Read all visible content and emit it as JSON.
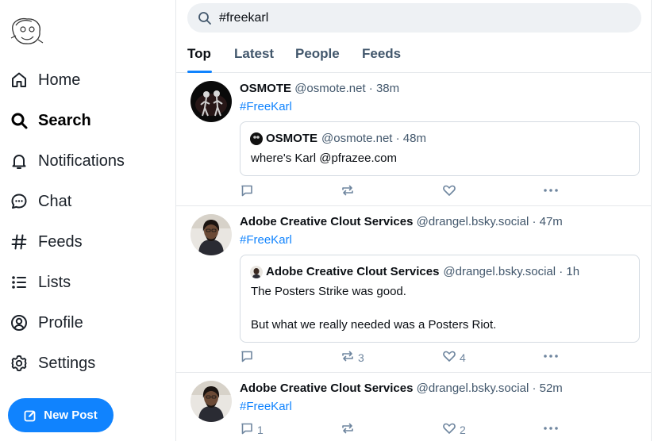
{
  "nav": {
    "items": [
      {
        "label": "Home",
        "icon": "home-icon"
      },
      {
        "label": "Search",
        "icon": "search-icon"
      },
      {
        "label": "Notifications",
        "icon": "bell-icon"
      },
      {
        "label": "Chat",
        "icon": "chat-icon"
      },
      {
        "label": "Feeds",
        "icon": "hash-icon"
      },
      {
        "label": "Lists",
        "icon": "list-icon"
      },
      {
        "label": "Profile",
        "icon": "profile-icon"
      },
      {
        "label": "Settings",
        "icon": "gear-icon"
      }
    ],
    "active": "Search",
    "new_post_label": "New Post"
  },
  "search": {
    "query": "#freekarl"
  },
  "tabs": [
    "Top",
    "Latest",
    "People",
    "Feeds"
  ],
  "colors": {
    "accent": "#1083fe",
    "muted": "#42576c",
    "icon_muted": "#6f869f"
  },
  "posts": [
    {
      "name": "OSMOTE",
      "handle": "@osmote.net · 38m",
      "tag": "#FreeKarl",
      "quote": {
        "name": "OSMOTE",
        "handle": "@osmote.net · 48m",
        "lines": [
          "where's Karl @pfrazee.com"
        ]
      },
      "reposts": "",
      "likes": "",
      "replies": ""
    },
    {
      "name": "Adobe Creative Clout Services",
      "handle": "@drangel.bsky.social · 47m",
      "tag": "#FreeKarl",
      "quote": {
        "name": "Adobe Creative Clout Services",
        "handle": "@drangel.bsky.social · 1h",
        "lines": [
          "The Posters Strike was good.",
          "But what we really needed was a Posters Riot."
        ]
      },
      "reposts": "3",
      "likes": "4",
      "replies": ""
    },
    {
      "name": "Adobe Creative Clout Services",
      "handle": "@drangel.bsky.social · 52m",
      "tag": "#FreeKarl",
      "replies": "1",
      "reposts": "",
      "likes": "2"
    }
  ]
}
